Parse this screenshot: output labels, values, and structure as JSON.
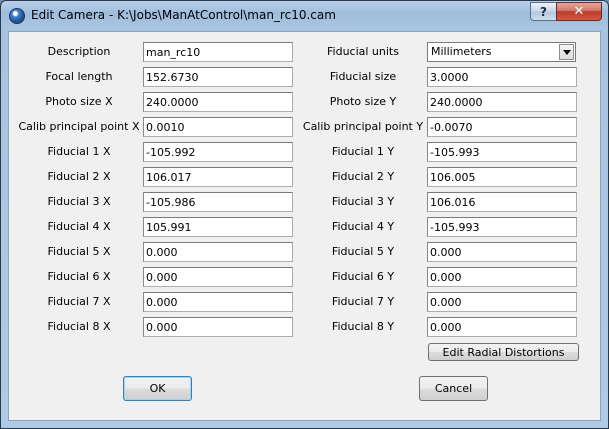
{
  "window": {
    "title": "Edit Camera - K:\\Jobs\\ManAtControl\\man_rc10.cam",
    "help_label": "?",
    "close_label": "✕"
  },
  "left_fields": [
    {
      "label": "Description",
      "value": "man_rc10"
    },
    {
      "label": "Focal length",
      "value": "152.6730"
    },
    {
      "label": "Photo size X",
      "value": "240.0000"
    },
    {
      "label": "Calib principal point X",
      "value": "0.0010"
    },
    {
      "label": "Fiducial 1 X",
      "value": "-105.992"
    },
    {
      "label": "Fiducial 2 X",
      "value": "106.017"
    },
    {
      "label": "Fiducial 3 X",
      "value": "-105.986"
    },
    {
      "label": "Fiducial 4 X",
      "value": "105.991"
    },
    {
      "label": "Fiducial 5 X",
      "value": "0.000"
    },
    {
      "label": "Fiducial 6 X",
      "value": "0.000"
    },
    {
      "label": "Fiducial 7 X",
      "value": "0.000"
    },
    {
      "label": "Fiducial 8 X",
      "value": "0.000"
    }
  ],
  "fiducial_units": {
    "label": "Fiducial units",
    "selected": "Millimeters"
  },
  "right_fields": [
    {
      "label": "Fiducial size",
      "value": "3.0000"
    },
    {
      "label": "Photo size Y",
      "value": "240.0000"
    },
    {
      "label": "Calib principal point Y",
      "value": "-0.0070"
    },
    {
      "label": "Fiducial 1 Y",
      "value": "-105.993"
    },
    {
      "label": "Fiducial 2 Y",
      "value": "106.005"
    },
    {
      "label": "Fiducial 3 Y",
      "value": "106.016"
    },
    {
      "label": "Fiducial 4 Y",
      "value": "-105.993"
    },
    {
      "label": "Fiducial 5 Y",
      "value": "0.000"
    },
    {
      "label": "Fiducial 6 Y",
      "value": "0.000"
    },
    {
      "label": "Fiducial 7 Y",
      "value": "0.000"
    },
    {
      "label": "Fiducial 8 Y",
      "value": "0.000"
    }
  ],
  "buttons": {
    "radial": "Edit Radial Distortions",
    "ok": "OK",
    "cancel": "Cancel"
  },
  "colors": {
    "title_bar": "#a8c4e0",
    "dialog_background": "#f0f0f0",
    "close_button": "#c7432f"
  }
}
